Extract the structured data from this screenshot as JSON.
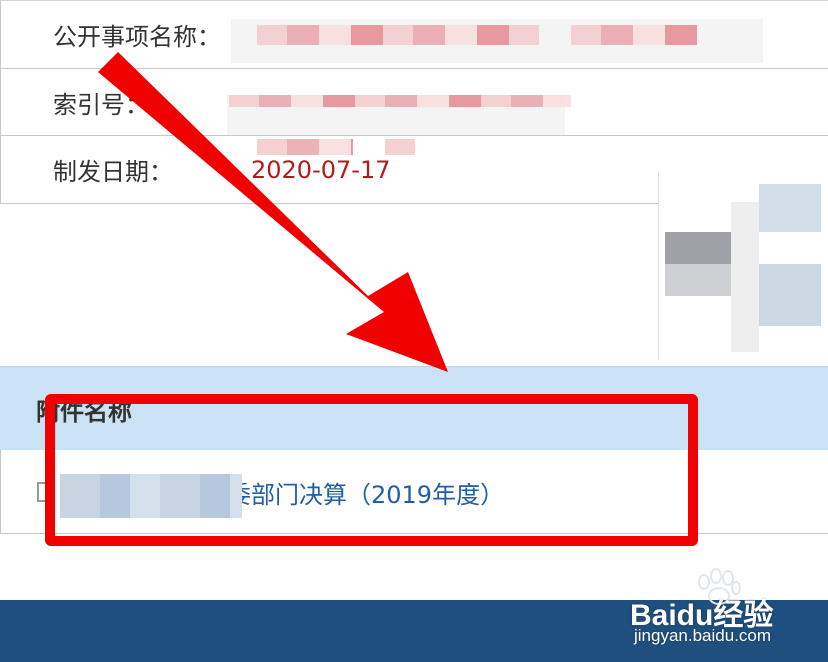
{
  "info": {
    "rows": [
      {
        "label": "公开事项名称：",
        "value": ""
      },
      {
        "label": "索引号：",
        "value": ""
      },
      {
        "label": "制发日期：",
        "value": "2020-07-17"
      }
    ]
  },
  "attachments": {
    "header": "附件名称",
    "items": [
      {
        "title": "委部门决算（2019年度）"
      }
    ]
  },
  "watermark": {
    "logo": "Baidu经验",
    "url": "jingyan.baidu.com"
  },
  "colors": {
    "date_red": "#b01c1c",
    "link_blue": "#1f5fa8",
    "header_bg": "#c9e3f5",
    "footer_bg": "#1f4f7e",
    "annotation_red": "#f00000"
  },
  "icons": [
    "file-icon",
    "arrow-annotation",
    "baidu-paw-icon"
  ]
}
